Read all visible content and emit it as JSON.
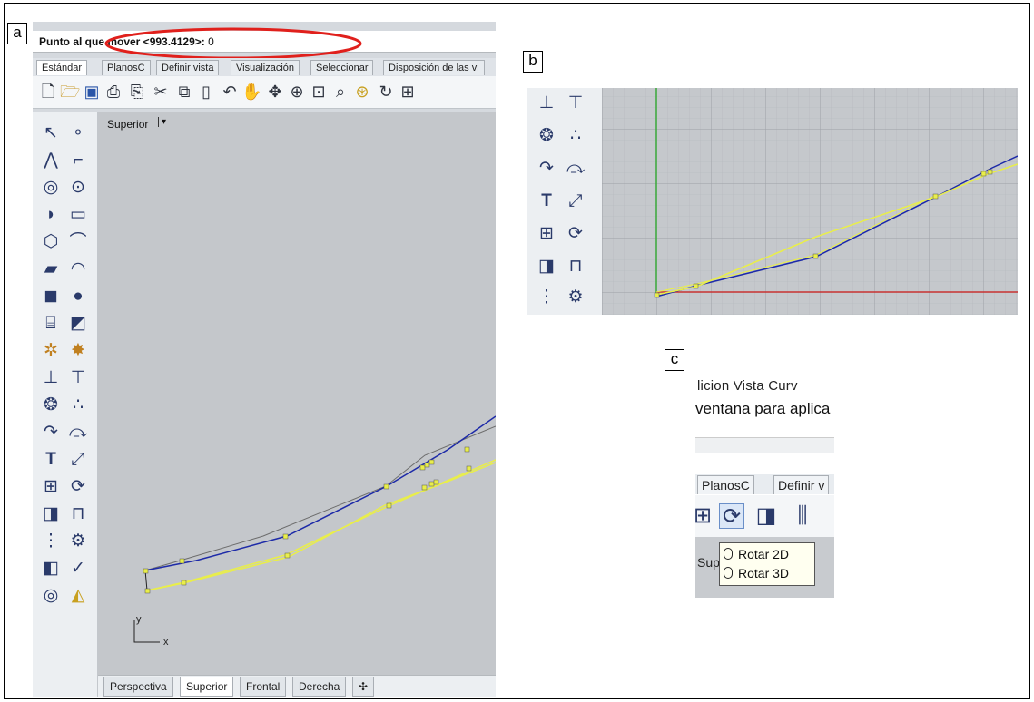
{
  "labels": {
    "a": "a",
    "b": "b",
    "c": "c"
  },
  "panel_a": {
    "command": {
      "prompt": "Punto al que mover <993.4129>:",
      "value": " 0"
    },
    "tabs": [
      "Estándar",
      "PlanosC",
      "Definir vista",
      "Visualización",
      "Seleccionar",
      "Disposición de las vi"
    ],
    "viewport_title": "Superior",
    "axis_y": "y",
    "axis_x": "x",
    "bottom_tabs": [
      "Perspectiva",
      "Superior",
      "Frontal",
      "Derecha"
    ],
    "add_tab_symbol": "✣"
  },
  "panel_c": {
    "menu": "licion   Vista   Curv",
    "message": "ventana para aplica",
    "tabs": [
      "PlanosC",
      "Definir v"
    ],
    "tooltip": [
      "Rotar 2D",
      "Rotar 3D"
    ]
  },
  "colors": {
    "highlight_ellipse": "#e0201c",
    "curve_blue": "#1d2aa8",
    "curve_yellow": "#e9ee4a",
    "grid": "#b0b3b7",
    "axis_green": "#3aa83a",
    "axis_red": "#c83232"
  }
}
